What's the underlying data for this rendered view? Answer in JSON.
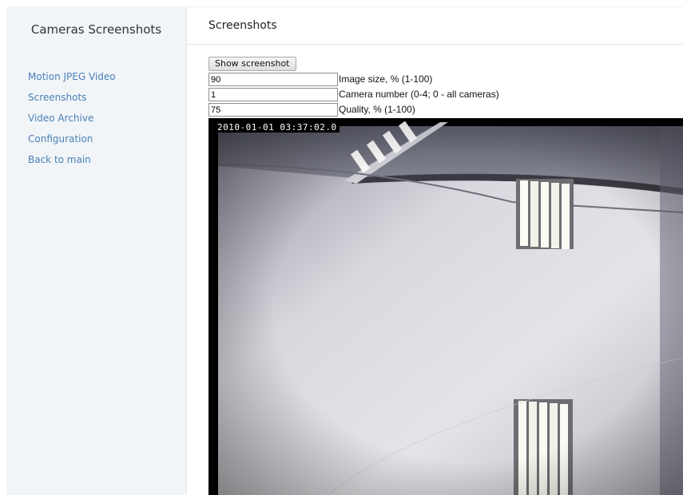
{
  "sidebar": {
    "title": "Cameras Screenshots",
    "items": [
      {
        "label": "Motion JPEG Video"
      },
      {
        "label": "Screenshots"
      },
      {
        "label": "Video Archive"
      },
      {
        "label": "Configuration"
      },
      {
        "label": "Back to main"
      }
    ]
  },
  "main": {
    "title": "Screenshots",
    "show_button_label": "Show screenshot",
    "fields": [
      {
        "value": "90",
        "label": "Image size, % (1-100)"
      },
      {
        "value": "1",
        "label": "Camera number (0-4; 0 - all cameras)"
      },
      {
        "value": "75",
        "label": "Quality, % (1-100)"
      }
    ],
    "screenshot": {
      "timestamp": "2010-01-01 03:37:02.0"
    }
  },
  "colors": {
    "link": "#4a7fb7",
    "sidebar_bg": "#f1f5f8"
  }
}
